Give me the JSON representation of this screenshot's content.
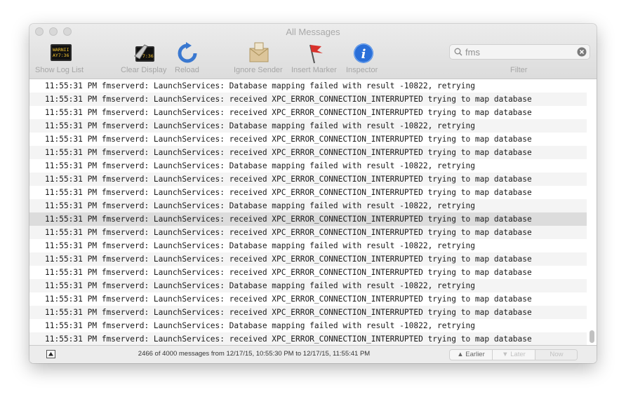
{
  "window": {
    "title": "All Messages"
  },
  "toolbar": {
    "show_log_list": "Show Log List",
    "log_icon_text": "WARNII\nAY7:36",
    "clear_display": "Clear Display",
    "clear_icon_text": "7:36",
    "reload": "Reload",
    "ignore_sender": "Ignore Sender",
    "insert_marker": "Insert Marker",
    "inspector": "Inspector",
    "inspector_icon_glyph": "i"
  },
  "search": {
    "value": "fms",
    "label": "Filter"
  },
  "log": {
    "selected_index": 10,
    "rows": [
      "11:55:31 PM fmserverd: LaunchServices: Database mapping failed with result -10822, retrying",
      "11:55:31 PM fmserverd: LaunchServices: received XPC_ERROR_CONNECTION_INTERRUPTED trying to map database",
      "11:55:31 PM fmserverd: LaunchServices: received XPC_ERROR_CONNECTION_INTERRUPTED trying to map database",
      "11:55:31 PM fmserverd: LaunchServices: Database mapping failed with result -10822, retrying",
      "11:55:31 PM fmserverd: LaunchServices: received XPC_ERROR_CONNECTION_INTERRUPTED trying to map database",
      "11:55:31 PM fmserverd: LaunchServices: received XPC_ERROR_CONNECTION_INTERRUPTED trying to map database",
      "11:55:31 PM fmserverd: LaunchServices: Database mapping failed with result -10822, retrying",
      "11:55:31 PM fmserverd: LaunchServices: received XPC_ERROR_CONNECTION_INTERRUPTED trying to map database",
      "11:55:31 PM fmserverd: LaunchServices: received XPC_ERROR_CONNECTION_INTERRUPTED trying to map database",
      "11:55:31 PM fmserverd: LaunchServices: Database mapping failed with result -10822, retrying",
      "11:55:31 PM fmserverd: LaunchServices: received XPC_ERROR_CONNECTION_INTERRUPTED trying to map database",
      "11:55:31 PM fmserverd: LaunchServices: received XPC_ERROR_CONNECTION_INTERRUPTED trying to map database",
      "11:55:31 PM fmserverd: LaunchServices: Database mapping failed with result -10822, retrying",
      "11:55:31 PM fmserverd: LaunchServices: received XPC_ERROR_CONNECTION_INTERRUPTED trying to map database",
      "11:55:31 PM fmserverd: LaunchServices: received XPC_ERROR_CONNECTION_INTERRUPTED trying to map database",
      "11:55:31 PM fmserverd: LaunchServices: Database mapping failed with result -10822, retrying",
      "11:55:31 PM fmserverd: LaunchServices: received XPC_ERROR_CONNECTION_INTERRUPTED trying to map database",
      "11:55:31 PM fmserverd: LaunchServices: received XPC_ERROR_CONNECTION_INTERRUPTED trying to map database",
      "11:55:31 PM fmserverd: LaunchServices: Database mapping failed with result -10822, retrying",
      "11:55:31 PM fmserverd: LaunchServices: received XPC_ERROR_CONNECTION_INTERRUPTED trying to map database"
    ]
  },
  "status": {
    "text": "2466 of 4000 messages from 12/17/15, 10:55:30 PM to 12/17/15, 11:55:41 PM",
    "earlier": "Earlier",
    "later": "Later",
    "now": "Now"
  },
  "colors": {
    "inspector_blue": "#2a6fd8",
    "reload_blue": "#3a78d0",
    "marker_red": "#d8312b",
    "row_alt": "#f4f4f4",
    "row_selected": "#dcdcdc"
  },
  "icons": {
    "show_log_list": "console-log-icon",
    "clear_display": "broom-console-icon",
    "reload": "reload-arrow-icon",
    "ignore_sender": "sender-envelope-icon",
    "insert_marker": "red-flag-pin-icon",
    "inspector": "info-icon",
    "search": "magnifier-icon",
    "clear_search": "clear-x-icon"
  }
}
